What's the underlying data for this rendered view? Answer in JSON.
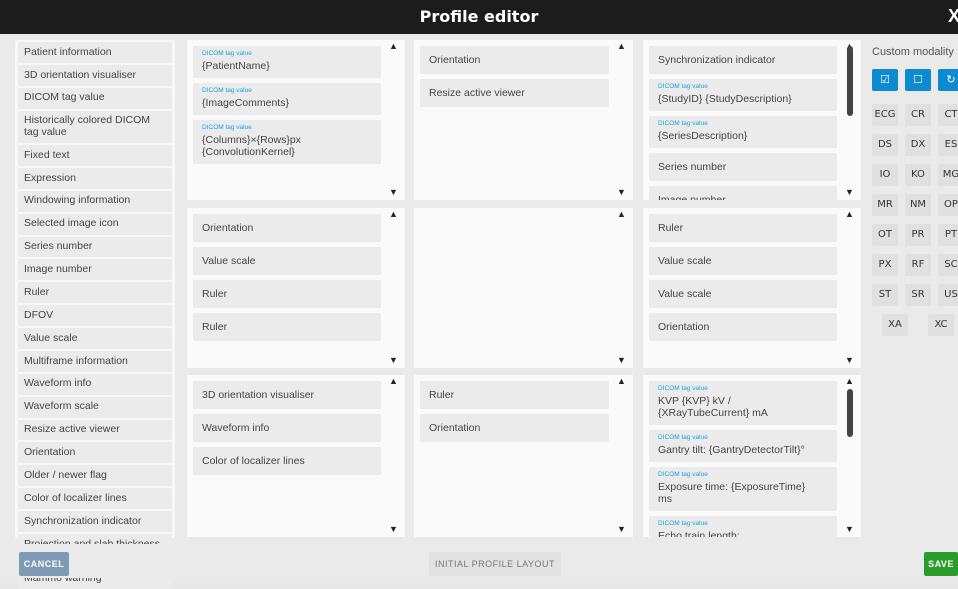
{
  "window": {
    "title": "Profile editor",
    "close_glyph": "X"
  },
  "element_list": [
    "Patient information",
    "3D orientation visualiser",
    "DICOM tag value",
    "Historically colored DICOM tag value",
    "Fixed text",
    "Expression",
    "Windowing information",
    "Selected image icon",
    "Series number",
    "Image number",
    "Ruler",
    "DFOV",
    "Value scale",
    "Multiframe information",
    "Waveform info",
    "Waveform scale",
    "Resize active viewer",
    "Orientation",
    "Older / newer flag",
    "Color of localizer lines",
    "Synchronization indicator",
    "Projection and slab thickness editor",
    "Mammo warning"
  ],
  "tag_label": "DICOM tag value",
  "cells": {
    "top_left": [
      {
        "tag": true,
        "value": "{PatientName}"
      },
      {
        "tag": true,
        "value": "{ImageComments}"
      },
      {
        "tag": true,
        "value": "{Columns}×{Rows}px\n{ConvolutionKernel}"
      }
    ],
    "top_center": [
      {
        "tag": false,
        "value": "Orientation"
      },
      {
        "tag": false,
        "value": "Resize active viewer"
      }
    ],
    "top_right": [
      {
        "tag": false,
        "value": "Synchronization indicator"
      },
      {
        "tag": true,
        "value": "{StudyID} {StudyDescription}"
      },
      {
        "tag": true,
        "value": "{SeriesDescription}"
      },
      {
        "tag": false,
        "value": "Series number"
      },
      {
        "tag": false,
        "value": "Image number"
      }
    ],
    "mid_left": [
      {
        "tag": false,
        "value": "Orientation"
      },
      {
        "tag": false,
        "value": "Value scale"
      },
      {
        "tag": false,
        "value": "Ruler"
      },
      {
        "tag": false,
        "value": "Ruler"
      }
    ],
    "mid_center": [],
    "mid_right": [
      {
        "tag": false,
        "value": "Ruler"
      },
      {
        "tag": false,
        "value": "Value scale"
      },
      {
        "tag": false,
        "value": "Value scale"
      },
      {
        "tag": false,
        "value": "Orientation"
      }
    ],
    "bot_left": [
      {
        "tag": false,
        "value": "3D orientation visualiser"
      },
      {
        "tag": false,
        "value": "Waveform info"
      },
      {
        "tag": false,
        "value": "Color of localizer lines"
      }
    ],
    "bot_center": [
      {
        "tag": false,
        "value": "Ruler"
      },
      {
        "tag": false,
        "value": "Orientation"
      }
    ],
    "bot_right": [
      {
        "tag": true,
        "value": "KVP {KVP} kV /\n{XRayTubeCurrent} mA"
      },
      {
        "tag": true,
        "value": "Gantry tilt: {GantryDetectorTilt}°"
      },
      {
        "tag": true,
        "value": "Exposure time: {ExposureTime}\nms"
      },
      {
        "tag": true,
        "value": "Echo train length:\n{EchoTrainLength}"
      },
      {
        "tag": true,
        "value": ""
      }
    ]
  },
  "modality": {
    "title": "Custom modality",
    "actions": [
      {
        "name": "select-all-checkbox-icon",
        "glyph": "☑"
      },
      {
        "name": "deselect-all-checkbox-icon",
        "glyph": "☐"
      },
      {
        "name": "refresh-icon",
        "glyph": "↻"
      }
    ],
    "codes": [
      "ECG",
      "CR",
      "CT",
      "DS",
      "DX",
      "ES",
      "IO",
      "KO",
      "MG",
      "MR",
      "NM",
      "OP",
      "OT",
      "PR",
      "PT",
      "PX",
      "RF",
      "SC",
      "ST",
      "SR",
      "US",
      "XA",
      "XC"
    ]
  },
  "footer": {
    "cancel_label": "CANCEL",
    "initial_layout_label": "INITIAL PROFILE LAYOUT",
    "save_label": "SAVE"
  },
  "colors": {
    "accent": "#0d8ad0",
    "save": "#2a9d2a",
    "cancel": "#7f9bb4",
    "tag_label": "#1aa3e0"
  }
}
